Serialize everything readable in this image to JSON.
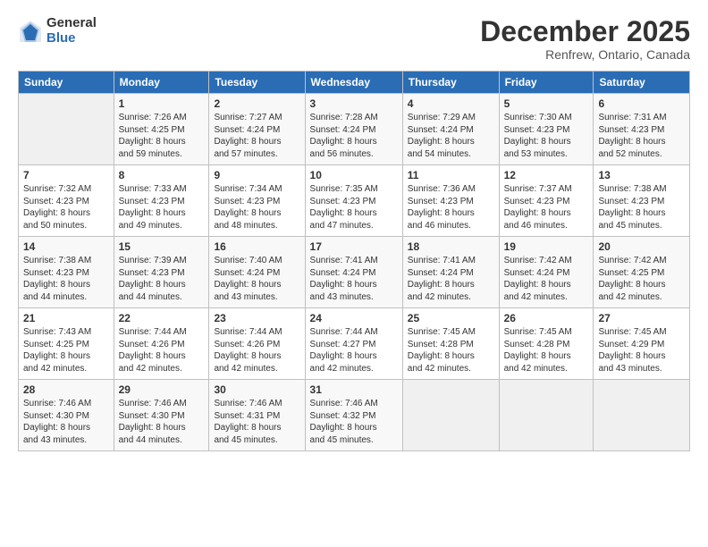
{
  "logo": {
    "general": "General",
    "blue": "Blue"
  },
  "title": "December 2025",
  "subtitle": "Renfrew, Ontario, Canada",
  "days_of_week": [
    "Sunday",
    "Monday",
    "Tuesday",
    "Wednesday",
    "Thursday",
    "Friday",
    "Saturday"
  ],
  "weeks": [
    [
      {
        "day": "",
        "info": ""
      },
      {
        "day": "1",
        "info": "Sunrise: 7:26 AM\nSunset: 4:25 PM\nDaylight: 8 hours\nand 59 minutes."
      },
      {
        "day": "2",
        "info": "Sunrise: 7:27 AM\nSunset: 4:24 PM\nDaylight: 8 hours\nand 57 minutes."
      },
      {
        "day": "3",
        "info": "Sunrise: 7:28 AM\nSunset: 4:24 PM\nDaylight: 8 hours\nand 56 minutes."
      },
      {
        "day": "4",
        "info": "Sunrise: 7:29 AM\nSunset: 4:24 PM\nDaylight: 8 hours\nand 54 minutes."
      },
      {
        "day": "5",
        "info": "Sunrise: 7:30 AM\nSunset: 4:23 PM\nDaylight: 8 hours\nand 53 minutes."
      },
      {
        "day": "6",
        "info": "Sunrise: 7:31 AM\nSunset: 4:23 PM\nDaylight: 8 hours\nand 52 minutes."
      }
    ],
    [
      {
        "day": "7",
        "info": "Sunrise: 7:32 AM\nSunset: 4:23 PM\nDaylight: 8 hours\nand 50 minutes."
      },
      {
        "day": "8",
        "info": "Sunrise: 7:33 AM\nSunset: 4:23 PM\nDaylight: 8 hours\nand 49 minutes."
      },
      {
        "day": "9",
        "info": "Sunrise: 7:34 AM\nSunset: 4:23 PM\nDaylight: 8 hours\nand 48 minutes."
      },
      {
        "day": "10",
        "info": "Sunrise: 7:35 AM\nSunset: 4:23 PM\nDaylight: 8 hours\nand 47 minutes."
      },
      {
        "day": "11",
        "info": "Sunrise: 7:36 AM\nSunset: 4:23 PM\nDaylight: 8 hours\nand 46 minutes."
      },
      {
        "day": "12",
        "info": "Sunrise: 7:37 AM\nSunset: 4:23 PM\nDaylight: 8 hours\nand 46 minutes."
      },
      {
        "day": "13",
        "info": "Sunrise: 7:38 AM\nSunset: 4:23 PM\nDaylight: 8 hours\nand 45 minutes."
      }
    ],
    [
      {
        "day": "14",
        "info": "Sunrise: 7:38 AM\nSunset: 4:23 PM\nDaylight: 8 hours\nand 44 minutes."
      },
      {
        "day": "15",
        "info": "Sunrise: 7:39 AM\nSunset: 4:23 PM\nDaylight: 8 hours\nand 44 minutes."
      },
      {
        "day": "16",
        "info": "Sunrise: 7:40 AM\nSunset: 4:24 PM\nDaylight: 8 hours\nand 43 minutes."
      },
      {
        "day": "17",
        "info": "Sunrise: 7:41 AM\nSunset: 4:24 PM\nDaylight: 8 hours\nand 43 minutes."
      },
      {
        "day": "18",
        "info": "Sunrise: 7:41 AM\nSunset: 4:24 PM\nDaylight: 8 hours\nand 42 minutes."
      },
      {
        "day": "19",
        "info": "Sunrise: 7:42 AM\nSunset: 4:24 PM\nDaylight: 8 hours\nand 42 minutes."
      },
      {
        "day": "20",
        "info": "Sunrise: 7:42 AM\nSunset: 4:25 PM\nDaylight: 8 hours\nand 42 minutes."
      }
    ],
    [
      {
        "day": "21",
        "info": "Sunrise: 7:43 AM\nSunset: 4:25 PM\nDaylight: 8 hours\nand 42 minutes."
      },
      {
        "day": "22",
        "info": "Sunrise: 7:44 AM\nSunset: 4:26 PM\nDaylight: 8 hours\nand 42 minutes."
      },
      {
        "day": "23",
        "info": "Sunrise: 7:44 AM\nSunset: 4:26 PM\nDaylight: 8 hours\nand 42 minutes."
      },
      {
        "day": "24",
        "info": "Sunrise: 7:44 AM\nSunset: 4:27 PM\nDaylight: 8 hours\nand 42 minutes."
      },
      {
        "day": "25",
        "info": "Sunrise: 7:45 AM\nSunset: 4:28 PM\nDaylight: 8 hours\nand 42 minutes."
      },
      {
        "day": "26",
        "info": "Sunrise: 7:45 AM\nSunset: 4:28 PM\nDaylight: 8 hours\nand 42 minutes."
      },
      {
        "day": "27",
        "info": "Sunrise: 7:45 AM\nSunset: 4:29 PM\nDaylight: 8 hours\nand 43 minutes."
      }
    ],
    [
      {
        "day": "28",
        "info": "Sunrise: 7:46 AM\nSunset: 4:30 PM\nDaylight: 8 hours\nand 43 minutes."
      },
      {
        "day": "29",
        "info": "Sunrise: 7:46 AM\nSunset: 4:30 PM\nDaylight: 8 hours\nand 44 minutes."
      },
      {
        "day": "30",
        "info": "Sunrise: 7:46 AM\nSunset: 4:31 PM\nDaylight: 8 hours\nand 45 minutes."
      },
      {
        "day": "31",
        "info": "Sunrise: 7:46 AM\nSunset: 4:32 PM\nDaylight: 8 hours\nand 45 minutes."
      },
      {
        "day": "",
        "info": ""
      },
      {
        "day": "",
        "info": ""
      },
      {
        "day": "",
        "info": ""
      }
    ]
  ]
}
